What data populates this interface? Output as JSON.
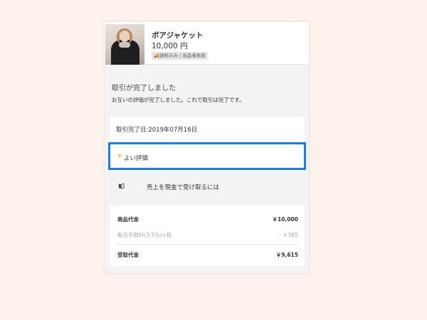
{
  "product": {
    "name": "ボアジャケット",
    "price": "10,000 円",
    "badge": "🚚送料込み | 出品者負担"
  },
  "transaction": {
    "title": "取引が完了しました",
    "message": "お互いの評価が完了しました。これで取引は完了です。",
    "completed_date": "取引完了日:2019年07月16日"
  },
  "rating": {
    "icon": "sun-icon",
    "label": "よい評価"
  },
  "cash_link": {
    "icon": "book-icon",
    "label": "売上を現金で受け取るには"
  },
  "summary": {
    "item_price_label": "商品代金",
    "item_price_value": "￥10,000",
    "fee_label": "販売手数料(3.5%)+税",
    "fee_value": "- ￥385",
    "received_label": "受取代金",
    "received_value": "￥9,615"
  },
  "colors": {
    "background": "#fdf2ec",
    "highlight_border": "#1d7ce5",
    "panel": "#f3f3f3"
  }
}
